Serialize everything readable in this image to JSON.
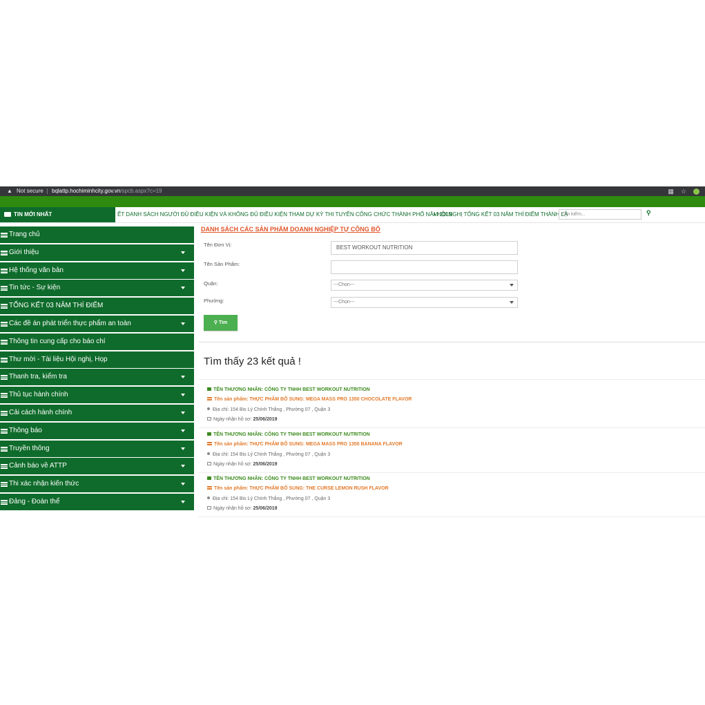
{
  "browser": {
    "security": "Not secure",
    "url_host": "bqlattp.hochiminhcity.gov.vn",
    "url_path": "/spcb.aspx?c=19"
  },
  "ticker": {
    "badge_label": "TIN MỚI NHẤT",
    "news_1": "ẾT DANH SÁCH NGƯỜI ĐỦ ĐIỀU KIỆN VÀ KHÔNG ĐỦ ĐIỀU KIỆN THAM DỰ KỲ THI TUYỂN CÔNG CHỨC THÀNH PHỐ NĂM 2019",
    "news_2": "HỘI NGHỊ TỔNG KẾT 03 NĂM THÍ ĐIỂM THÀNH LẬ",
    "search_placeholder": "Tìm kiếm..."
  },
  "sidebar": {
    "items": [
      {
        "label": "Trang chủ",
        "has_caret": false
      },
      {
        "label": "Giới thiệu",
        "has_caret": true
      },
      {
        "label": "Hệ thống văn bản",
        "has_caret": true
      },
      {
        "label": "Tin tức - Sự kiện",
        "has_caret": true
      },
      {
        "label": "TỔNG KẾT 03 NĂM THÍ ĐIỂM",
        "has_caret": false
      },
      {
        "label": "Các đề án phát triển thực phẩm an toàn",
        "has_caret": true
      },
      {
        "label": "Thông tin cung cấp cho báo chí",
        "has_caret": false
      },
      {
        "label": "Thư mời - Tài liệu Hội nghị, Họp",
        "has_caret": false
      },
      {
        "label": "Thanh tra, kiểm tra",
        "has_caret": true
      },
      {
        "label": "Thủ tục hành chính",
        "has_caret": true
      },
      {
        "label": "Cải cách hành chính",
        "has_caret": true
      },
      {
        "label": "Thông báo",
        "has_caret": true
      },
      {
        "label": "Truyền thông",
        "has_caret": true
      },
      {
        "label": "Cảnh báo về ATTP",
        "has_caret": true
      },
      {
        "label": "Thi xác nhận kiến thức",
        "has_caret": true
      },
      {
        "label": "Đảng - Đoàn thể",
        "has_caret": true
      }
    ]
  },
  "main": {
    "heading": "DANH SÁCH CÁC SẢN PHẨM DOANH NGHIỆP TỰ CÔNG BỐ",
    "form": {
      "unit_label": "Tên Đơn Vị:",
      "unit_value": "BEST WORKOUT NUTRITION",
      "product_label": "Tên Sản Phẩm:",
      "product_value": "",
      "district_label": "Quận:",
      "district_value": "---Chọn---",
      "ward_label": "Phường:",
      "ward_value": "---Chọn---",
      "search_button": "Tìm"
    },
    "results_title": "Tìm thấy 23 kết quả !",
    "results": [
      {
        "merchant": "TÊN THƯƠNG NHÂN: CÔNG TY TNHH BEST WORKOUT NUTRITION",
        "product": "Tên sản phẩm: THỰC PHẨM BỔ SUNG: MEGA MASS PRO 1350 CHOCOLATE FLAVOR",
        "address": "Địa chỉ: 154 Bis Lý Chính Thắng , Phường 07 , Quận 3",
        "date_label": "Ngày nhận hồ sơ:",
        "date": "25/06/2019"
      },
      {
        "merchant": "TÊN THƯƠNG NHÂN: CÔNG TY TNHH BEST WORKOUT NUTRITION",
        "product": "Tên sản phẩm: THỰC PHẨM BỔ SUNG: MEGA MASS PRO 1350 BANANA FLAVOR",
        "address": "Địa chỉ: 154 Bis Lý Chính Thắng , Phường 07 , Quận 3",
        "date_label": "Ngày nhận hồ sơ:",
        "date": "25/06/2019"
      },
      {
        "merchant": "TÊN THƯƠNG NHÂN: CÔNG TY TNHH BEST WORKOUT NUTRITION",
        "product": "Tên sản phẩm: THỰC PHẨM BỔ SUNG: THE CURSE LEMON RUSH FLAVOR",
        "address": "Địa chỉ: 154 Bis Lý Chính Thắng , Phường 07 , Quận 3",
        "date_label": "Ngày nhận hồ sơ:",
        "date": "25/06/2019"
      }
    ]
  },
  "colors": {
    "brand_green": "#0f6b2b",
    "nav_green": "#2e8b0f",
    "accent_orange": "#e27a2b",
    "button_green": "#4caf50"
  }
}
